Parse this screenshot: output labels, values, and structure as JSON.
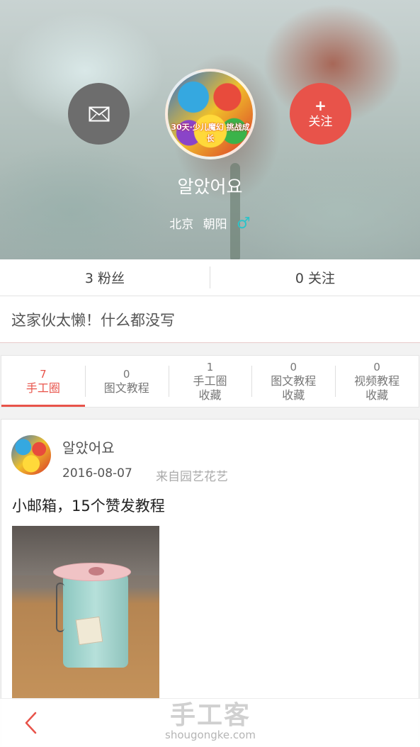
{
  "profile": {
    "username": "알았어요",
    "avatar_text": "30天·少儿魔幻 挑战成长",
    "city": "北京",
    "district": "朝阳",
    "gender_symbol": "♂",
    "message_icon": "envelope-icon",
    "follow_plus": "+",
    "follow_label": "关注"
  },
  "stats": {
    "fans": "3 粉丝",
    "following": "0 关注"
  },
  "bio": "这家伙太懒！什么都没写",
  "tabs": [
    {
      "count": "7",
      "label": "手工圈",
      "active": true
    },
    {
      "count": "0",
      "label": "图文教程"
    },
    {
      "count": "1",
      "label": "手工圈\n收藏"
    },
    {
      "count": "0",
      "label": "图文教程\n收藏"
    },
    {
      "count": "0",
      "label": "视频教程\n收藏"
    }
  ],
  "post": {
    "username": "알았어요",
    "date": "2016-08-07",
    "source": "来自园艺花艺",
    "title": "小邮箱，15个赞发教程"
  },
  "bottom_bar": {
    "back_icon": "chevron-left-icon",
    "watermark_logo": "手工客",
    "watermark_url": "shougongke.com"
  },
  "colors": {
    "accent": "#e8534a",
    "gender": "#2ec3c8"
  }
}
